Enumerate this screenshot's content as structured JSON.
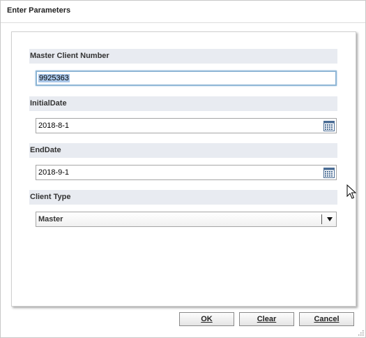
{
  "dialog": {
    "title": "Enter Parameters"
  },
  "params": {
    "master_client_number": {
      "label": "Master Client Number",
      "value": "9925363"
    },
    "initial_date": {
      "label": "InitialDate",
      "value": "2018-8-1"
    },
    "end_date": {
      "label": "EndDate",
      "value": "2018-9-1"
    },
    "client_type": {
      "label": "Client Type",
      "selected": "Master"
    }
  },
  "buttons": {
    "ok": "OK",
    "clear": "Clear",
    "cancel": "Cancel"
  }
}
